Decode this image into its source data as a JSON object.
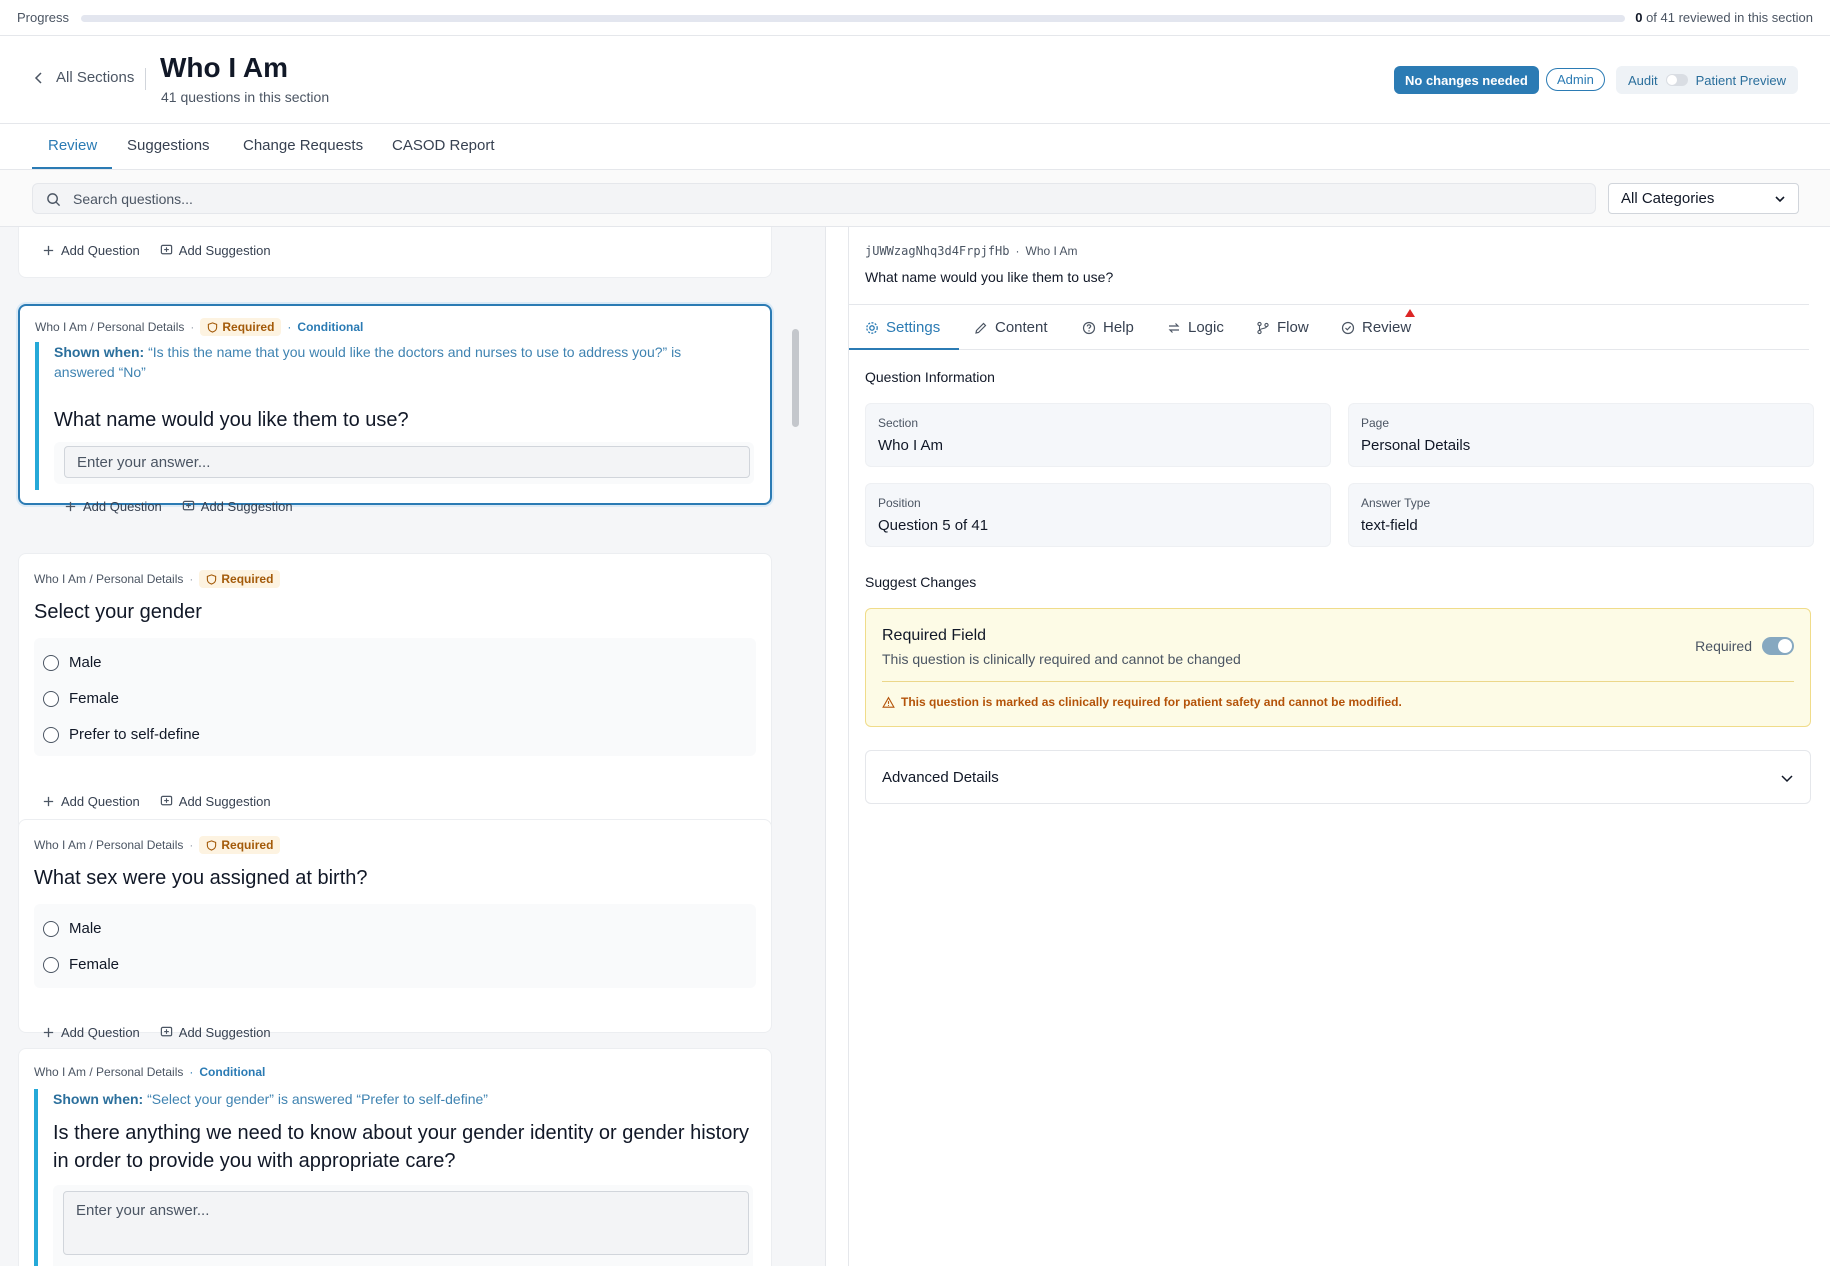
{
  "progress": {
    "label": "Progress",
    "reviewed": 0,
    "total": 41,
    "reviewed_text": "0",
    "suffix_text": "of 41 reviewed in this section",
    "fraction": 0.0
  },
  "header": {
    "back_label": "All Sections",
    "title": "Who I Am",
    "subtitle": "41 questions in this section",
    "primary_button": "No changes needed",
    "role_badge": "Admin",
    "mode_left": "Audit",
    "mode_right": "Patient Preview"
  },
  "tabs": [
    {
      "label": "Review",
      "active": true
    },
    {
      "label": "Suggestions",
      "active": false
    },
    {
      "label": "Change Requests",
      "active": false
    },
    {
      "label": "CASOD Report",
      "active": false
    }
  ],
  "search": {
    "placeholder": "Search questions...",
    "category_value": "All Categories"
  },
  "card_actions": {
    "add_question": "Add Question",
    "add_suggestion": "Add Suggestion"
  },
  "tags": {
    "required": "Required",
    "conditional": "Conditional",
    "shown_when": "Shown when:"
  },
  "questions": [
    {
      "breadcrumb": "Who I Am / Personal Details",
      "condition": "“Is this the name that you would like the doctors and nurses to use to address you?” is answered “No”",
      "title": "What name would you like them to use?",
      "placeholder": "Enter your answer..."
    },
    {
      "breadcrumb": "Who I Am / Personal Details",
      "title": "Select your gender",
      "options": [
        "Male",
        "Female",
        "Prefer to self-define"
      ]
    },
    {
      "breadcrumb": "Who I Am / Personal Details",
      "title": "What sex were you assigned at birth?",
      "options": [
        "Male",
        "Female"
      ]
    },
    {
      "breadcrumb": "Who I Am / Personal Details",
      "condition": "“Select your gender” is answered “Prefer to self-define”",
      "title": "Is there anything we need to know about your gender identity or gender history in order to provide you with appropriate care?",
      "placeholder": "Enter your answer..."
    }
  ],
  "detail": {
    "question_id": "jUWWzagNhq3d4FrpjfHb",
    "section_crumb": "Who I Am",
    "question_text": "What name would you like them to use?",
    "tabs": [
      {
        "label": "Settings",
        "icon": "gear-icon",
        "active": true
      },
      {
        "label": "Content",
        "icon": "pencil-icon",
        "active": false
      },
      {
        "label": "Help",
        "icon": "help-circle-icon",
        "active": false
      },
      {
        "label": "Logic",
        "icon": "arrows-swap-icon",
        "active": false
      },
      {
        "label": "Flow",
        "icon": "branch-icon",
        "active": false
      },
      {
        "label": "Review",
        "icon": "check-circle-icon",
        "active": false
      }
    ],
    "info_heading": "Question Information",
    "info": [
      {
        "label": "Section",
        "value": "Who I Am"
      },
      {
        "label": "Page",
        "value": "Personal Details"
      },
      {
        "label": "Position",
        "value": "Question 5 of 41"
      },
      {
        "label": "Answer Type",
        "value": "text-field"
      }
    ],
    "suggest_heading": "Suggest Changes",
    "required_field": {
      "title": "Required Field",
      "description": "This question is clinically required and cannot be changed",
      "switch_label": "Required",
      "warning": "This question is marked as clinically required for patient safety and cannot be modified."
    },
    "advanced_label": "Advanced Details"
  },
  "colors": {
    "accent": "#2b7bb4",
    "conditional_bar": "#25a9d8",
    "required_bg": "#fdf3e1",
    "required_text": "#a35a09",
    "warning_box": "#fdfbe6"
  }
}
